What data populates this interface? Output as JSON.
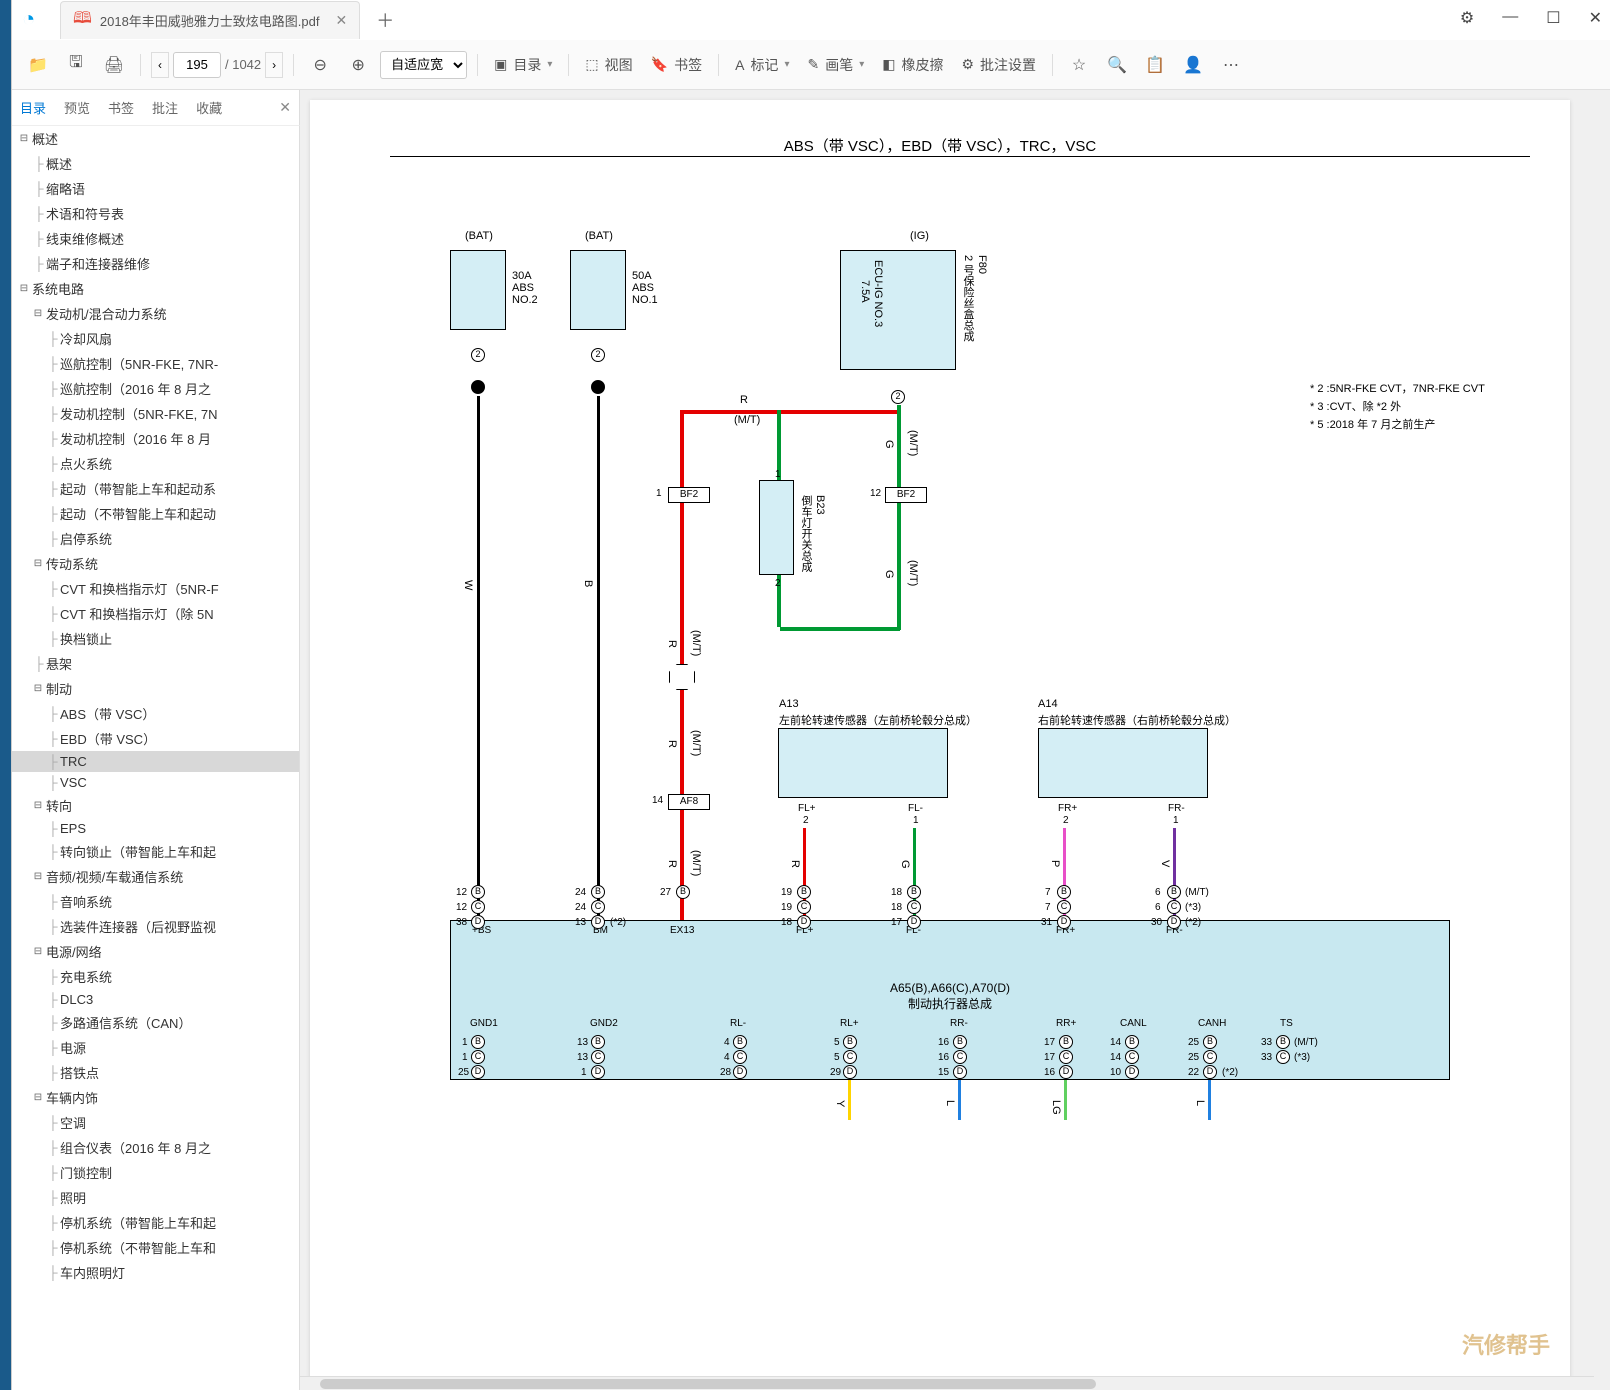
{
  "app": {
    "tab_title": "2018年丰田威驰雅力士致炫电路图.pdf"
  },
  "win": {
    "gear": "⚙",
    "min": "—",
    "max": "☐",
    "close": "✕"
  },
  "toolbar": {
    "page_current": "195",
    "page_total": "/ 1042",
    "zoom_mode": "自适应宽",
    "catalog": "目录",
    "view": "视图",
    "bookmark": "书签",
    "mark": "标记",
    "brush": "画笔",
    "eraser": "橡皮擦",
    "batch": "批注设置"
  },
  "subtabs": {
    "t1": "目录",
    "t2": "预览",
    "t3": "书签",
    "t4": "批注",
    "t5": "收藏"
  },
  "outline": [
    {
      "level": 0,
      "exp": "-",
      "label": "概述"
    },
    {
      "level": 1,
      "label": "概述"
    },
    {
      "level": 1,
      "label": "缩略语"
    },
    {
      "level": 1,
      "label": "术语和符号表"
    },
    {
      "level": 1,
      "label": "线束维修概述"
    },
    {
      "level": 1,
      "label": "端子和连接器维修"
    },
    {
      "level": 0,
      "exp": "-",
      "label": "系统电路"
    },
    {
      "level": 1,
      "exp": "-",
      "label": "发动机/混合动力系统"
    },
    {
      "level": 2,
      "label": "冷却风扇"
    },
    {
      "level": 2,
      "label": "巡航控制（5NR-FKE, 7NR-"
    },
    {
      "level": 2,
      "label": "巡航控制（2016 年 8 月之"
    },
    {
      "level": 2,
      "label": "发动机控制（5NR-FKE, 7N"
    },
    {
      "level": 2,
      "label": "发动机控制（2016 年 8 月"
    },
    {
      "level": 2,
      "label": "点火系统"
    },
    {
      "level": 2,
      "label": "起动（带智能上车和起动系"
    },
    {
      "level": 2,
      "label": "起动（不带智能上车和起动"
    },
    {
      "level": 2,
      "label": "启停系统"
    },
    {
      "level": 1,
      "exp": "-",
      "label": "传动系统"
    },
    {
      "level": 2,
      "label": "CVT 和换档指示灯（5NR-F"
    },
    {
      "level": 2,
      "label": "CVT 和换档指示灯（除 5N"
    },
    {
      "level": 2,
      "label": "换档锁止"
    },
    {
      "level": 1,
      "label": "悬架"
    },
    {
      "level": 1,
      "exp": "-",
      "label": "制动"
    },
    {
      "level": 2,
      "label": "ABS（带 VSC）"
    },
    {
      "level": 2,
      "label": "EBD（带 VSC）"
    },
    {
      "level": 2,
      "label": "TRC",
      "selected": true
    },
    {
      "level": 2,
      "label": "VSC"
    },
    {
      "level": 1,
      "exp": "-",
      "label": "转向"
    },
    {
      "level": 2,
      "label": "EPS"
    },
    {
      "level": 2,
      "label": "转向锁止（带智能上车和起"
    },
    {
      "level": 1,
      "exp": "-",
      "label": "音频/视频/车载通信系统"
    },
    {
      "level": 2,
      "label": "音响系统"
    },
    {
      "level": 2,
      "label": "选装件连接器（后视野监视"
    },
    {
      "level": 1,
      "exp": "-",
      "label": "电源/网络"
    },
    {
      "level": 2,
      "label": "充电系统"
    },
    {
      "level": 2,
      "label": "DLC3"
    },
    {
      "level": 2,
      "label": "多路通信系统（CAN）"
    },
    {
      "level": 2,
      "label": "电源"
    },
    {
      "level": 2,
      "label": "搭铁点"
    },
    {
      "level": 1,
      "exp": "-",
      "label": "车辆内饰"
    },
    {
      "level": 2,
      "label": "空调"
    },
    {
      "level": 2,
      "label": "组合仪表（2016 年 8 月之"
    },
    {
      "level": 2,
      "label": "门锁控制"
    },
    {
      "level": 2,
      "label": "照明"
    },
    {
      "level": 2,
      "label": "停机系统（带智能上车和起"
    },
    {
      "level": 2,
      "label": "停机系统（不带智能上车和"
    },
    {
      "level": 2,
      "label": "车内照明灯"
    }
  ],
  "diagram": {
    "title": "ABS（带 VSC），EBD（带 VSC），TRC，VSC",
    "bat1": "(BAT)",
    "bat2": "(BAT)",
    "ig": "(IG)",
    "fuse1": "30A\nABS\nNO.2",
    "fuse2": "50A\nABS\nNO.1",
    "fuse3_a": "7.5A",
    "fuse3_b": "ECU-IG NO.3",
    "fusebox": "F80\n2 号保险丝盒总成",
    "conn_bf2": "BF2",
    "conn_af8": "AF8",
    "b23": "B23\n倒车灯开关总成",
    "wire_r": "R",
    "wire_mt": "(M/T)",
    "wire_g": "G",
    "wire_w": "W",
    "wire_b": "B",
    "a13": "A13",
    "a13_label": "左前轮转速传感器（左前桥轮毂分总成）",
    "a14": "A14",
    "a14_label": "右前轮转速传感器（右前桥轮毂分总成）",
    "flp": "FL+",
    "flm": "FL-",
    "frp": "FR+",
    "frm": "FR-",
    "module_line1": "A65(B),A66(C),A70(D)",
    "module_line2": "制动执行器总成",
    "pins_top": {
      "bs": "+BS",
      "bm": "BM",
      "ex13": "EX13",
      "flp": "FL+",
      "flm": "FL-",
      "frp": "FR+",
      "frm": "FR-"
    },
    "pins_bot": {
      "gnd1": "GND1",
      "gnd2": "GND2",
      "rlm": "RL-",
      "rlp": "RL+",
      "rrm": "RR-",
      "rrp": "RR+",
      "canl": "CANL",
      "canh": "CANH",
      "ts": "TS"
    },
    "pin12": "12",
    "pin24": "24",
    "pin27": "27",
    "pin19": "19",
    "pin18": "18",
    "pin7": "7",
    "pin6": "6",
    "pin38": "38",
    "pin13": "13",
    "pin17": "17",
    "pin31": "31",
    "pin30": "30",
    "pin1": "1",
    "pin4": "4",
    "pin5": "5",
    "pin16": "16",
    "pin14": "14",
    "pin25": "25",
    "pin33": "33",
    "pin28": "28",
    "pin29": "29",
    "pin15": "15",
    "pin10": "10",
    "pin22": "22",
    "note_mt": "(M/T)",
    "note_s3": "(*3)",
    "note_s2": "(*2)",
    "legend1": "* 2 :5NR-FKE CVT，7NR-FKE CVT",
    "legend2": "* 3 :CVT、除 *2 外",
    "legend3": "* 5 :2018 年 7 月之前生产",
    "watermark": "汽修帮手"
  }
}
